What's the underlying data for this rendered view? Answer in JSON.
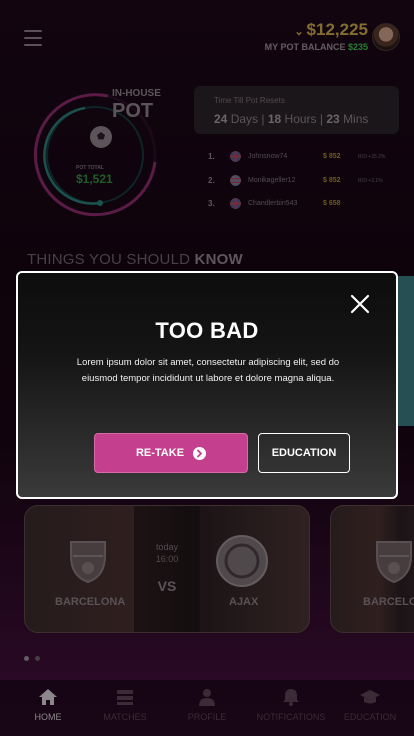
{
  "header": {
    "balance": "$12,225",
    "pot_balance_label": "MY POT BALANCE",
    "pot_balance_value": "$235"
  },
  "pot": {
    "small_label": "IN-HOUSE",
    "big_label": "POT",
    "total_label": "POT TOTAL",
    "total_value": "$1,521"
  },
  "timer": {
    "label": "Time Till Pot Resets",
    "days": "24",
    "days_unit": "Days",
    "hours": "18",
    "hours_unit": "Hours",
    "mins": "23",
    "mins_unit": "Mins"
  },
  "leaderboard": [
    {
      "rank": "1.",
      "name": "Johnsnow74",
      "amount": "$ 852",
      "roi": "ROI +25.2%"
    },
    {
      "rank": "2.",
      "name": "Monikageller12",
      "amount": "$ 852",
      "roi": "ROI +3.1%"
    },
    {
      "rank": "3.",
      "name": "Chandlerbin543",
      "amount": "$ 658",
      "roi": ""
    }
  ],
  "section": {
    "things_prefix": "THINGS YOU SHOULD ",
    "things_bold": "KNOW"
  },
  "matches": [
    {
      "home": "BARCELONA",
      "away": "AJAX",
      "day": "today",
      "time": "16:00",
      "vs": "VS"
    },
    {
      "home": "BARCELONA"
    }
  ],
  "nav": [
    {
      "label": "HOME",
      "icon": "home-icon",
      "active": true
    },
    {
      "label": "MATCHES",
      "icon": "matches-icon",
      "active": false
    },
    {
      "label": "PROFILE",
      "icon": "profile-icon",
      "active": false
    },
    {
      "label": "NOTIFICATIONS",
      "icon": "bell-icon",
      "active": false
    },
    {
      "label": "EDUCATION",
      "icon": "graduation-cap-icon",
      "active": false
    }
  ],
  "modal": {
    "title": "TOO BAD",
    "body": "Lorem ipsum dolor sit amet, consectetur adipiscing elit, sed do eiusmod tempor incididunt ut labore et dolore magna aliqua.",
    "retake_label": "RE-TAKE",
    "education_label": "EDUCATION"
  },
  "colors": {
    "accent": "#c4408e",
    "gold": "#c9a94a",
    "green": "#3fbf4f"
  }
}
